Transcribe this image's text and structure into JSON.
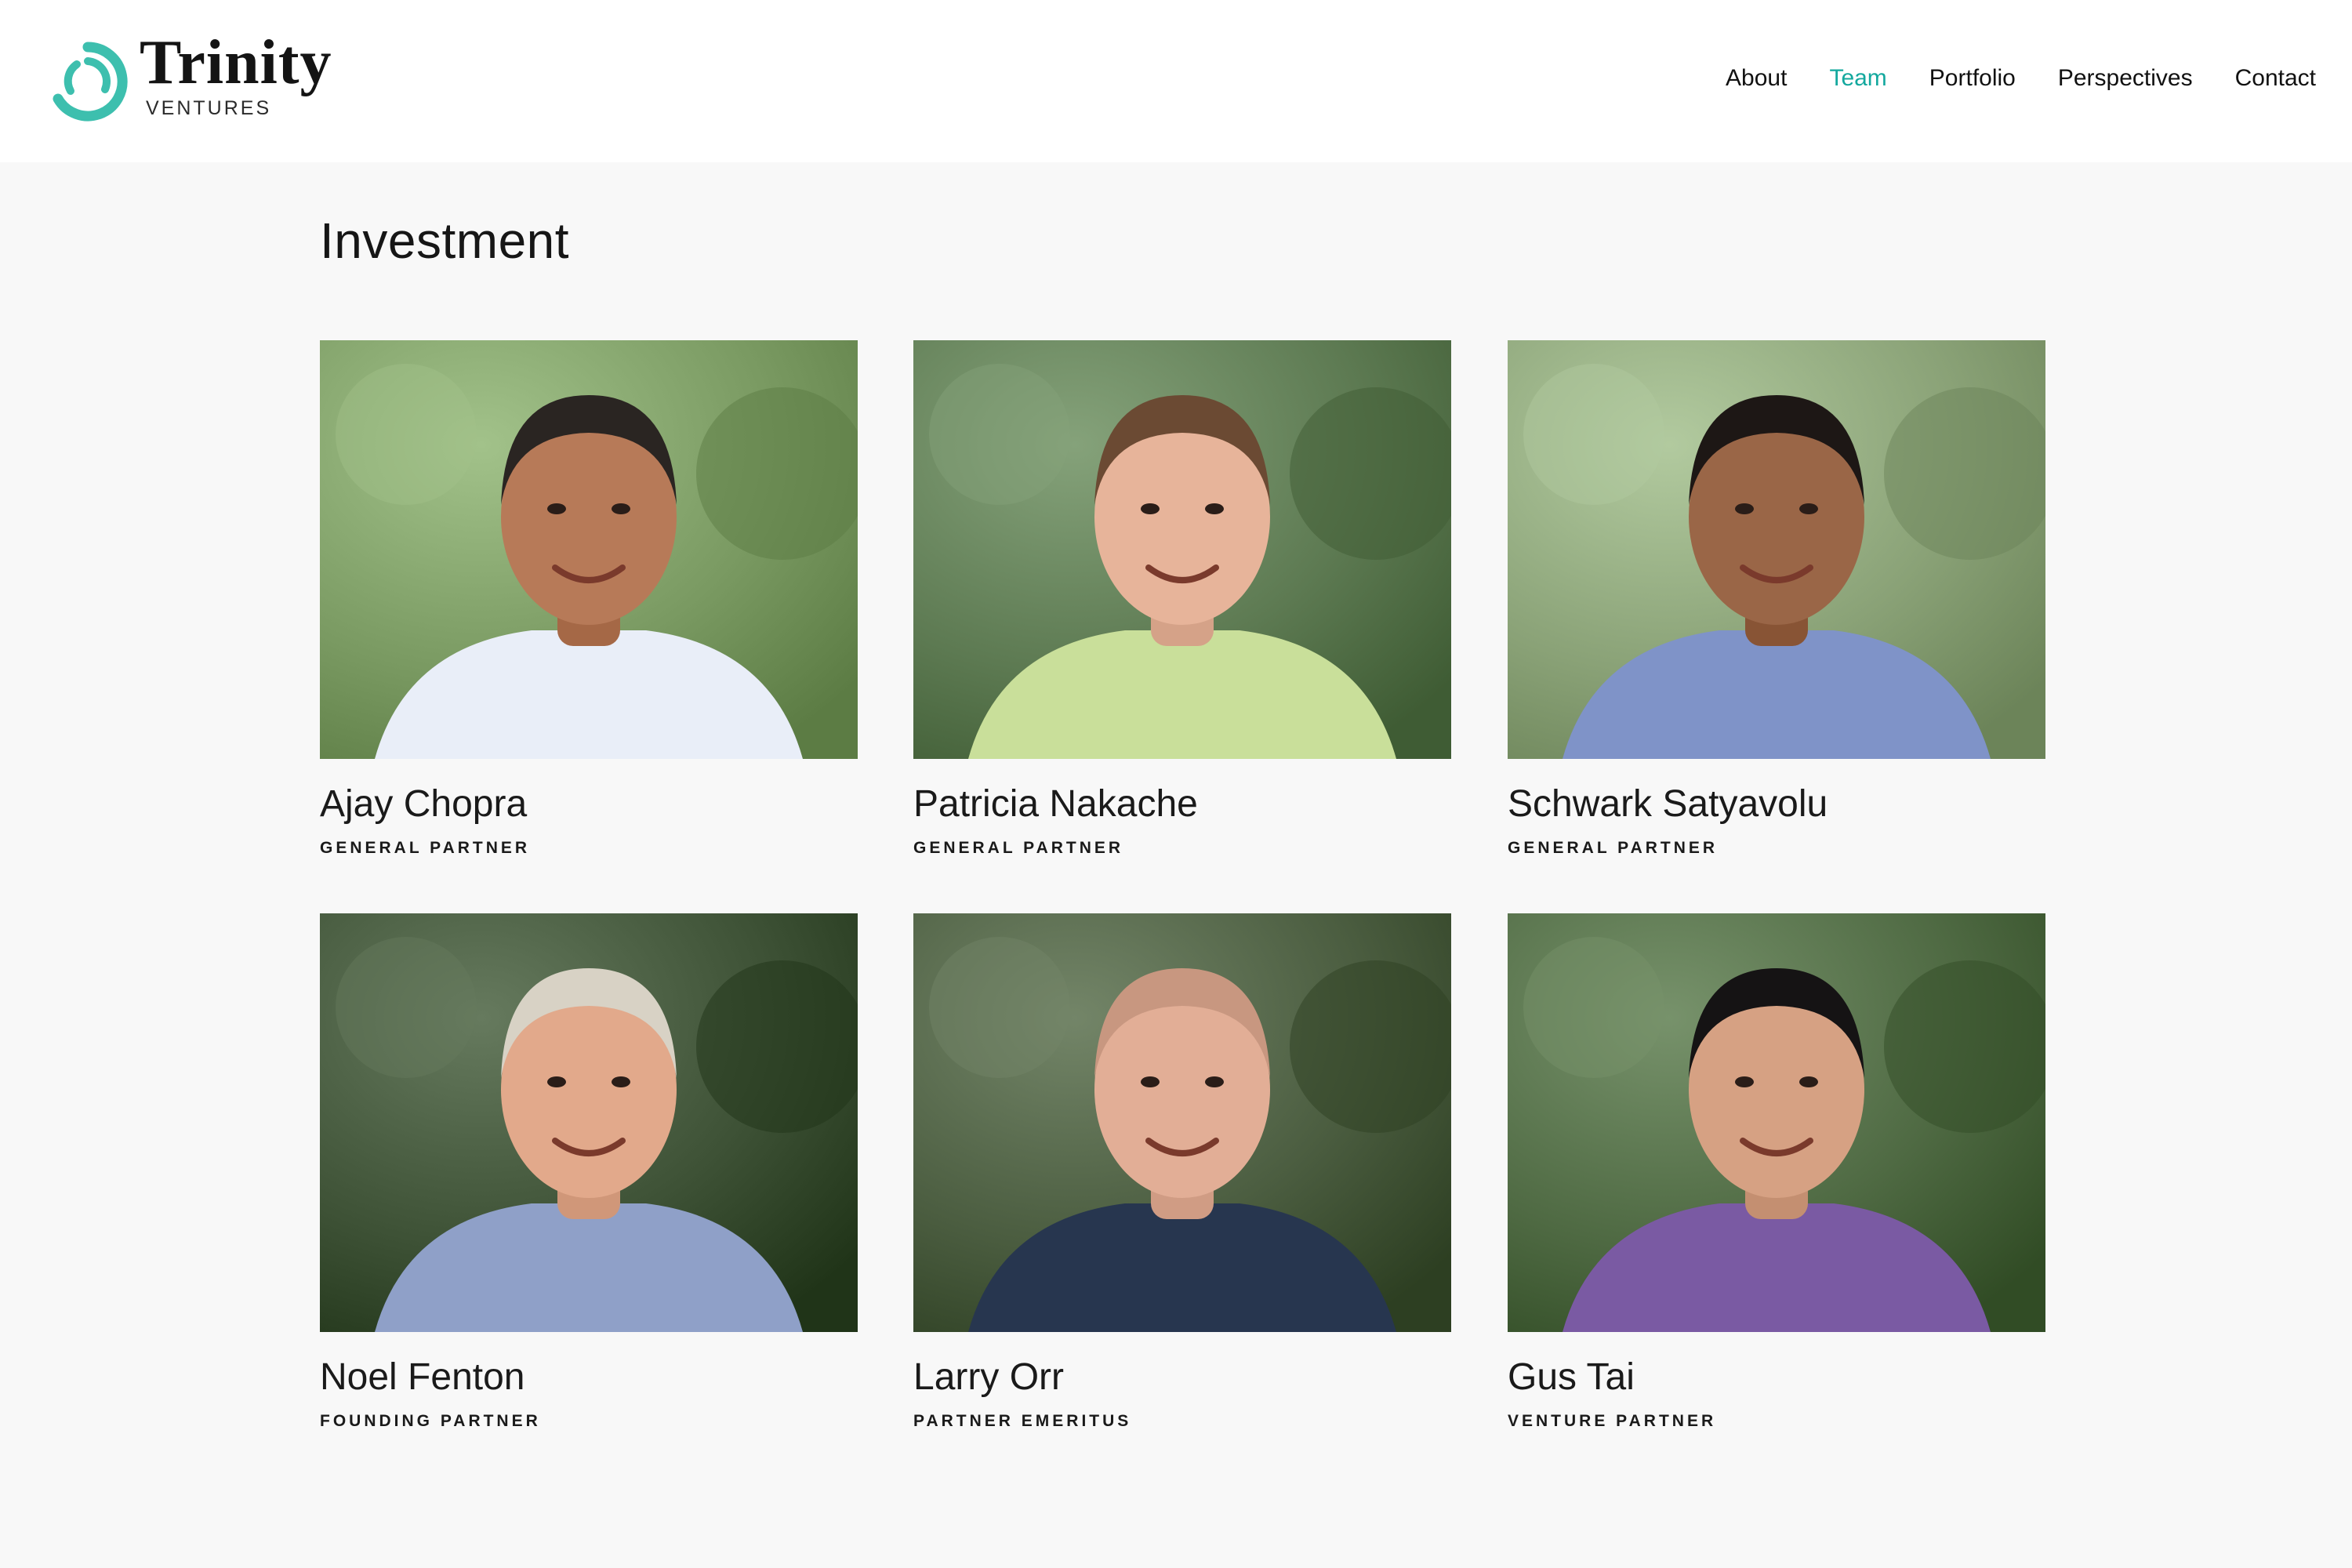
{
  "logo": {
    "word": "Trinity",
    "sub": "VENTURES",
    "color": "#3dbfae"
  },
  "nav": {
    "items": [
      {
        "label": "About",
        "active": false
      },
      {
        "label": "Team",
        "active": true
      },
      {
        "label": "Portfolio",
        "active": false
      },
      {
        "label": "Perspectives",
        "active": false
      },
      {
        "label": "Contact",
        "active": false
      }
    ],
    "active_color": "#13a89e"
  },
  "section": {
    "title": "Investment"
  },
  "team": [
    {
      "name": "Ajay Chopra",
      "role": "GENERAL PARTNER",
      "shirt": "#e9eef8",
      "skin": "#b77a58",
      "hair": "#2a2522",
      "bg": "#7a9a62"
    },
    {
      "name": "Patricia Nakache",
      "role": "GENERAL PARTNER",
      "shirt": "#c9df9a",
      "skin": "#e7b49a",
      "hair": "#6b4a33",
      "bg": "#5d7a52"
    },
    {
      "name": "Schwark Satyavolu",
      "role": "GENERAL PARTNER",
      "shirt": "#7f93c8",
      "skin": "#9a6647",
      "hair": "#1d1715",
      "bg": "#8aa277"
    },
    {
      "name": "Noel Fenton",
      "role": "FOUNDING PARTNER",
      "shirt": "#8fa0c8",
      "skin": "#e2a98b",
      "hair": "#d8d2c5",
      "bg": "#3e5236"
    },
    {
      "name": "Larry Orr",
      "role": "PARTNER EMERITUS",
      "shirt": "#27364f",
      "skin": "#e2ae96",
      "hair": "#c89780",
      "bg": "#4b5d40"
    },
    {
      "name": "Gus Tai",
      "role": "VENTURE PARTNER",
      "shirt": "#7a5aa3",
      "skin": "#d6a183",
      "hair": "#151314",
      "bg": "#4f6a43"
    }
  ]
}
